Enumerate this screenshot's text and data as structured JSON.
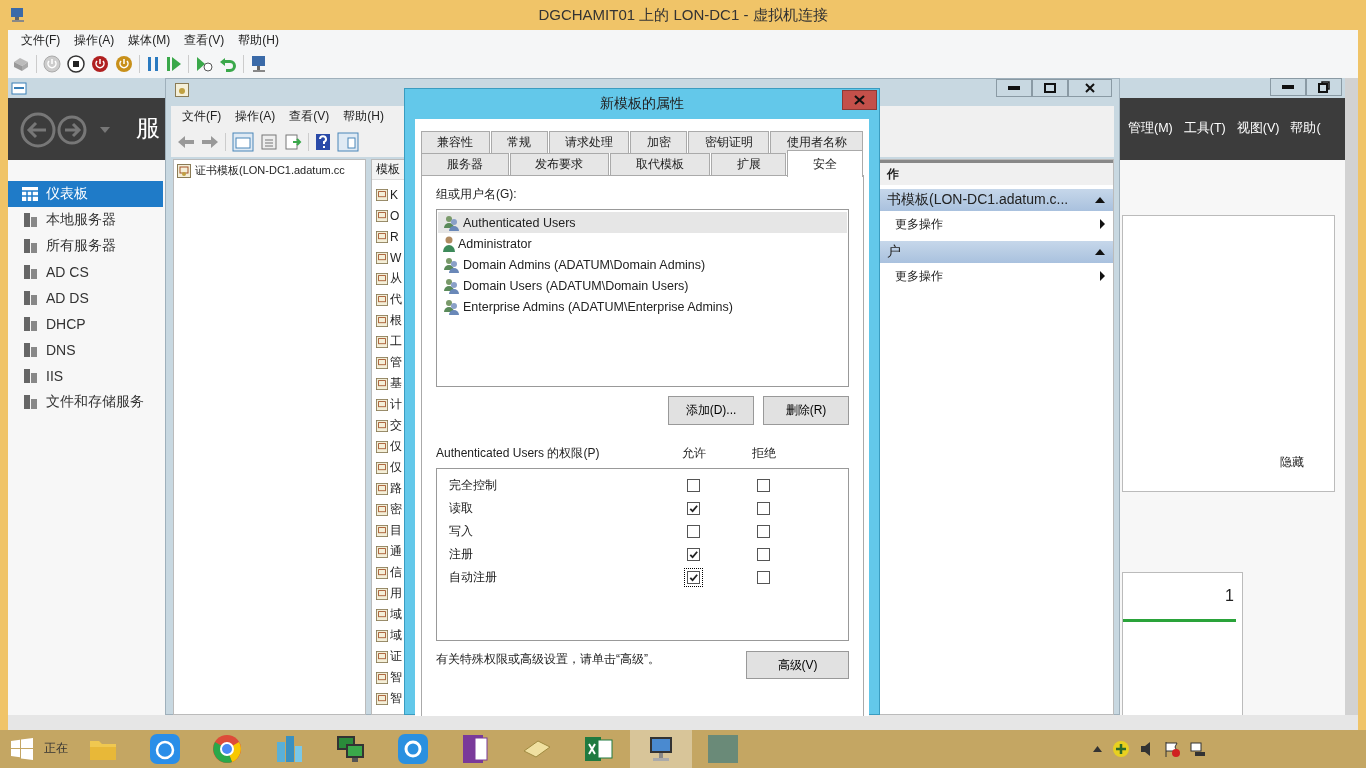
{
  "window": {
    "title": "DGCHAMIT01 上的 LON-DC1 - 虚拟机连接"
  },
  "menu": [
    "文件(F)",
    "操作(A)",
    "媒体(M)",
    "查看(V)",
    "帮助(H)"
  ],
  "server_manager": {
    "header_title": "服",
    "top_menu": [
      "管理(M)",
      "工具(T)",
      "视图(V)",
      "帮助("
    ],
    "nav": [
      {
        "label": "仪表板",
        "selected": true
      },
      {
        "label": "本地服务器",
        "selected": false
      },
      {
        "label": "所有服务器",
        "selected": false
      },
      {
        "label": "AD CS",
        "selected": false
      },
      {
        "label": "AD DS",
        "selected": false
      },
      {
        "label": "DHCP",
        "selected": false
      },
      {
        "label": "DNS",
        "selected": false
      },
      {
        "label": "IIS",
        "selected": false
      },
      {
        "label": "文件和存储服务",
        "selected": false
      }
    ],
    "panel_link": "隐藏",
    "tile_count": "1"
  },
  "console": {
    "menu": [
      "文件(F)",
      "操作(A)",
      "查看(V)",
      "帮助(H)"
    ],
    "tree_item": "证书模板(LON-DC1.adatum.cc",
    "list_header": "模板",
    "list_rows": [
      "K",
      "O",
      "R",
      "W",
      "从",
      "代",
      "根",
      "工",
      "管",
      "基",
      "计",
      "交",
      "仅",
      "仅",
      "路",
      "密",
      "目",
      "通",
      "信",
      "用",
      "域",
      "域",
      "证",
      "智",
      "智"
    ],
    "actions": {
      "header": "作",
      "sections": [
        {
          "title": "书模板(LON-DC1.adatum.c...",
          "items": [
            "更多操作"
          ]
        },
        {
          "title": "户",
          "items": [
            "更多操作"
          ]
        }
      ]
    }
  },
  "dialog": {
    "title": "新模板的属性",
    "tab_rows": [
      {
        "tabs": [
          {
            "label": "兼容性",
            "selected": false
          },
          {
            "label": "常规",
            "selected": false
          },
          {
            "label": "请求处理",
            "selected": false
          },
          {
            "label": "加密",
            "selected": false
          },
          {
            "label": "密钥证明",
            "selected": false
          },
          {
            "label": "使用者名称",
            "selected": false
          }
        ]
      },
      {
        "tabs": [
          {
            "label": "服务器",
            "selected": false
          },
          {
            "label": "发布要求",
            "selected": false
          },
          {
            "label": "取代模板",
            "selected": false
          },
          {
            "label": "扩展",
            "selected": false
          },
          {
            "label": "安全",
            "selected": true
          }
        ]
      }
    ],
    "group_label": "组或用户名(G):",
    "users": [
      {
        "name": "Authenticated Users",
        "kind": "group",
        "selected": true
      },
      {
        "name": "Administrator",
        "kind": "user",
        "selected": false
      },
      {
        "name": "Domain Admins (ADATUM\\Domain Admins)",
        "kind": "group",
        "selected": false
      },
      {
        "name": "Domain Users (ADATUM\\Domain Users)",
        "kind": "group",
        "selected": false
      },
      {
        "name": "Enterprise Admins (ADATUM\\Enterprise Admins)",
        "kind": "group",
        "selected": false
      }
    ],
    "user_buttons": [
      "添加(D)...",
      "删除(R)"
    ],
    "permissions_label": "Authenticated Users 的权限(P)",
    "allow_header": "允许",
    "deny_header": "拒绝",
    "permissions": [
      {
        "name": "完全控制",
        "allow": false,
        "deny": false,
        "focused": false
      },
      {
        "name": "读取",
        "allow": true,
        "deny": false,
        "focused": false
      },
      {
        "name": "写入",
        "allow": false,
        "deny": false,
        "focused": false
      },
      {
        "name": "注册",
        "allow": true,
        "deny": false,
        "focused": false
      },
      {
        "name": "自动注册",
        "allow": true,
        "deny": false,
        "focused": true
      }
    ],
    "advanced_note": "有关特殊权限或高级设置，请单击“高级”。",
    "advanced_button": "高级(V)"
  },
  "taskbar": {
    "start_label": "正在"
  }
}
